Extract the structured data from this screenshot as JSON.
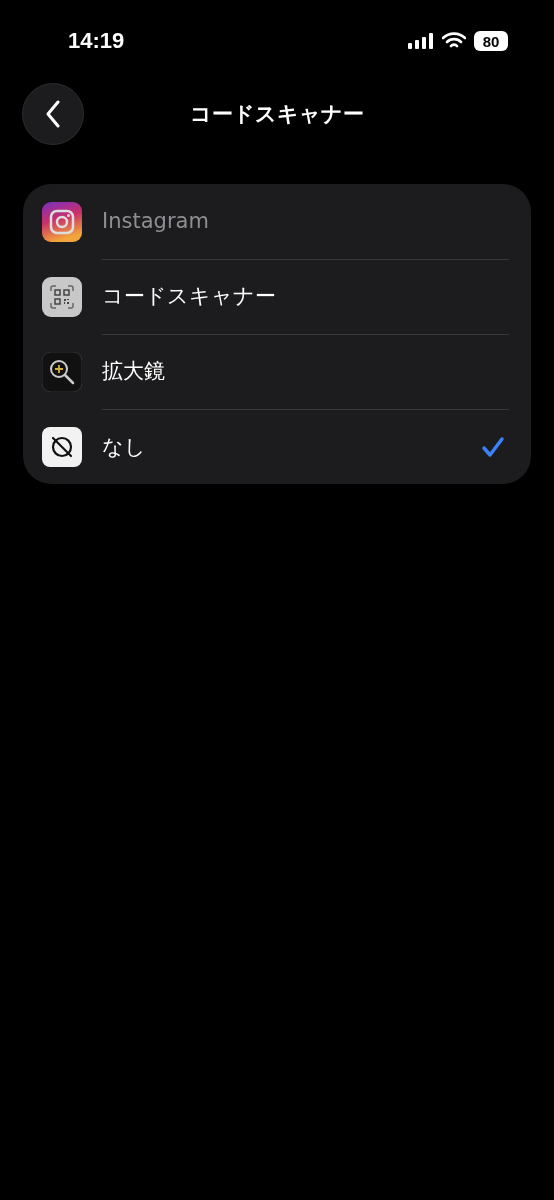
{
  "status_bar": {
    "time": "14:19",
    "battery": "80"
  },
  "nav": {
    "title": "コードスキャナー"
  },
  "options": [
    {
      "kind": "instagram",
      "label": "Instagram",
      "disabled": true,
      "selected": false
    },
    {
      "kind": "qr",
      "label": "コードスキャナー",
      "disabled": false,
      "selected": false
    },
    {
      "kind": "magnifier",
      "label": "拡大鏡",
      "disabled": false,
      "selected": false
    },
    {
      "kind": "none",
      "label": "なし",
      "disabled": false,
      "selected": true
    }
  ]
}
